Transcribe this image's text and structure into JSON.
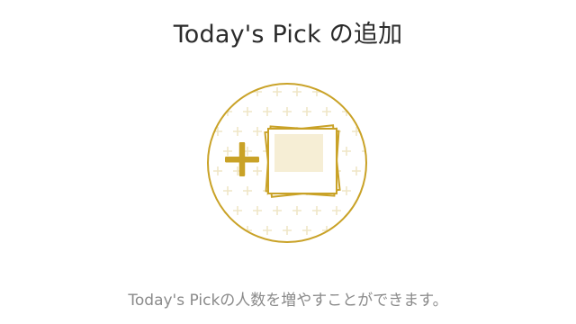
{
  "dialog": {
    "title": "Today's Pick の追加",
    "description": "Today's Pickの人数を増やすことができます。"
  },
  "illustration": {
    "icon": "add-photos-icon",
    "accent_color": "#c9a227",
    "pattern_color": "#efe6c6",
    "photo_fill_color": "#f6eed5"
  }
}
